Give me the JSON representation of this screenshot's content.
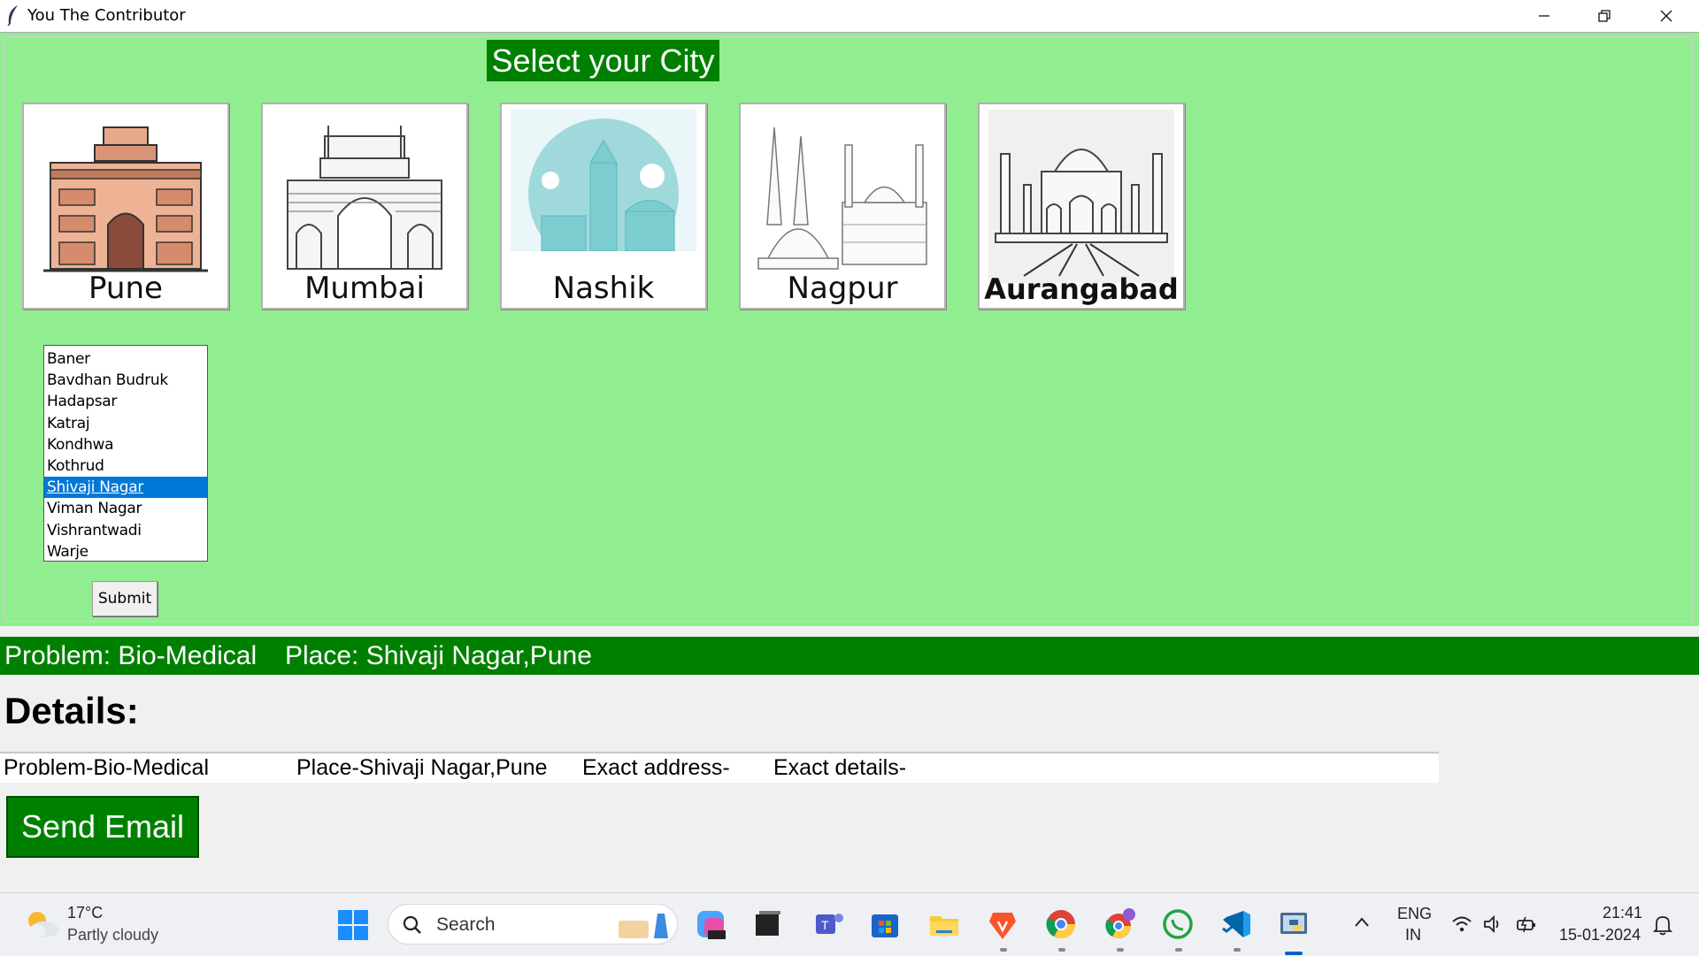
{
  "window": {
    "title": "You The Contributor"
  },
  "heading": "Select your City",
  "cities": [
    {
      "label": "Pune",
      "icon": "pune-landmark-icon"
    },
    {
      "label": "Mumbai",
      "icon": "gateway-of-india-icon"
    },
    {
      "label": "Nashik",
      "icon": "nashik-temple-icon"
    },
    {
      "label": "Nagpur",
      "icon": "nagpur-landmark-icon"
    },
    {
      "label": "Aurangabad",
      "icon": "bibi-ka-maqbara-icon"
    }
  ],
  "areas": {
    "items": [
      "Baner",
      "Bavdhan Budruk",
      "Hadapsar",
      "Katraj",
      "Kondhwa",
      "Kothrud",
      "Shivaji Nagar",
      "Viman Nagar",
      "Vishrantwadi",
      "Warje"
    ],
    "selected": "Shivaji Nagar"
  },
  "submit_label": "Submit",
  "status": {
    "problem": "Problem: Bio-Medical",
    "place": "Place: Shivaji Nagar,Pune"
  },
  "details": {
    "label": "Details:",
    "problem": "Problem-Bio-Medical",
    "place": "Place-Shivaji Nagar,Pune",
    "address": "Exact address-",
    "extra": "Exact details-"
  },
  "send_email_label": "Send Email",
  "colors": {
    "frame_bg": "#90ee90",
    "accent_green": "#008000",
    "selection": "#0078d7"
  },
  "taskbar": {
    "weather": {
      "temp": "17°C",
      "desc": "Partly cloudy"
    },
    "search_placeholder": "Search",
    "lang_line1": "ENG",
    "lang_line2": "IN",
    "time": "21:41",
    "date": "15-01-2024"
  }
}
